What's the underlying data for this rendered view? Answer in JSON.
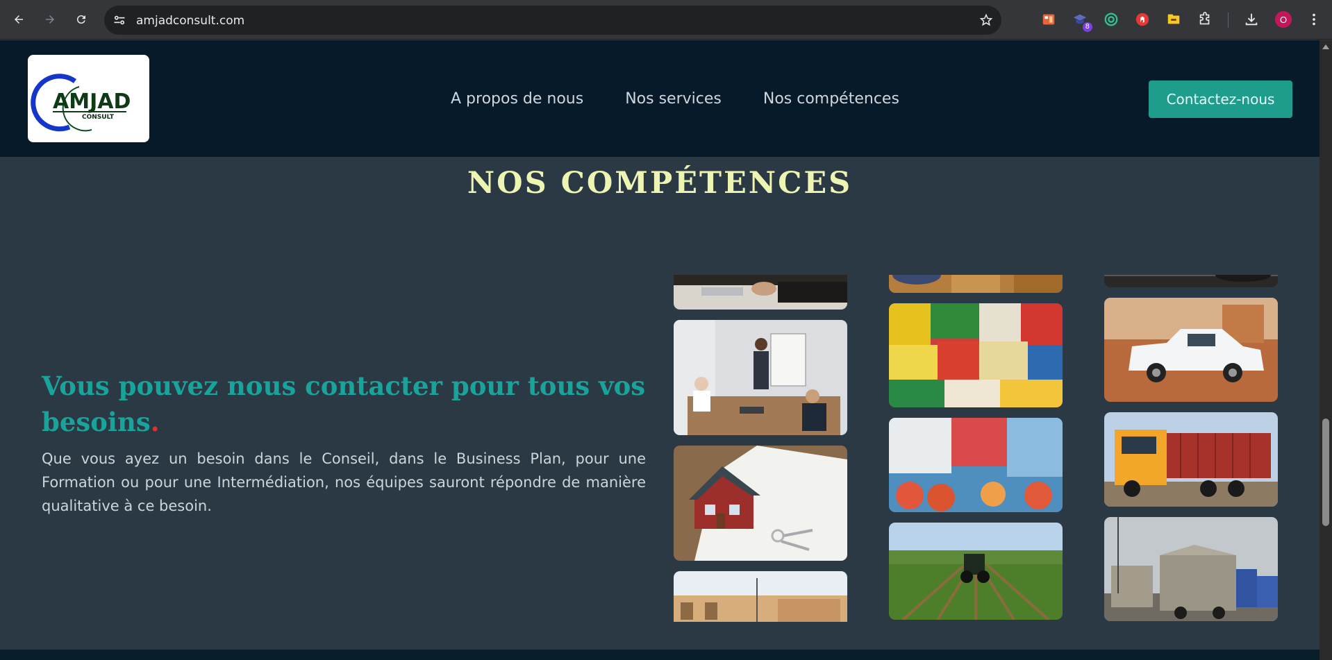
{
  "browser": {
    "url": "amjadconsult.com",
    "extension_badge": "8",
    "profile_initial": "O"
  },
  "header": {
    "logo_text": "AMJAD",
    "logo_subtext": "CONSULT",
    "nav": [
      "A propos de nous",
      "Nos services",
      "Nos compétences"
    ],
    "cta_label": "Contactez-nous"
  },
  "section": {
    "title": "NOS COMPÉTENCES",
    "headline": "Vous pouvez nous contacter pour tous vos besoins",
    "headline_dot": ".",
    "body": "Que vous ayez un besoin dans le Conseil, dans le Business Plan, pour une Formation ou pour une Intermédiation, nos équipes sauront répondre de manière qualitative à ce besoin."
  },
  "gallery": {
    "columns": [
      [
        "meeting-laptops-photo",
        "presentation-whiteboard-photo",
        "house-model-keys-photo",
        "buildings-street-photo"
      ],
      [
        "market-baskets-photo",
        "grocery-goods-photo",
        "rice-sacks-gas-bottles-photo",
        "tractor-field-photo"
      ],
      [
        "car-photo",
        "white-pickup-truck-photo",
        "container-truck-photo",
        "loaded-trucks-photo"
      ]
    ]
  },
  "colors": {
    "header_bg": "#061a2a",
    "content_bg": "#2b3944",
    "accent": "#1e9c8c",
    "title_color": "#eef5b3",
    "headline_color": "#19a39a",
    "dot_color": "#e0322f"
  }
}
